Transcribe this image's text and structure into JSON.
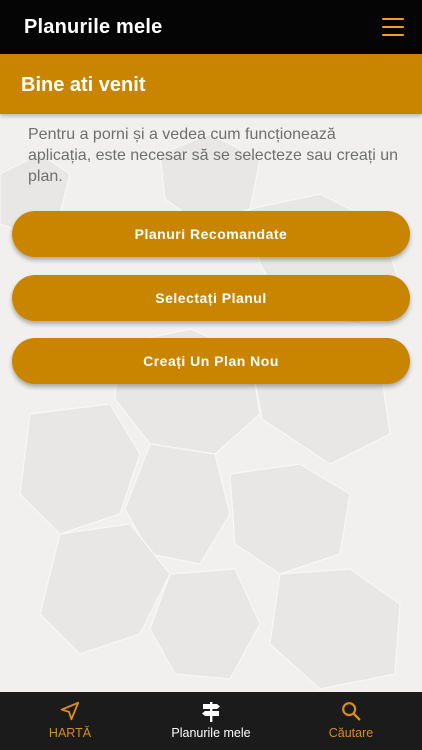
{
  "header": {
    "title": "Planurile mele",
    "menu_icon": "hamburger-menu-icon",
    "accent": "#f0a020"
  },
  "welcome": {
    "title": "Bine ati venit",
    "color": "#c98500"
  },
  "intro": {
    "text": "Pentru a porni și a vedea cum funcționează aplicația, este necesar să se selecteze sau creați un plan."
  },
  "buttons": [
    {
      "label": "Planuri Recomandate"
    },
    {
      "label": "Selectați Planul"
    },
    {
      "label": "Creați Un Plan Nou"
    }
  ],
  "tabs": [
    {
      "label": "HARTĂ",
      "icon": "navigation-arrow-icon",
      "active": false
    },
    {
      "label": "Planurile mele",
      "icon": "signpost-icon",
      "active": true
    },
    {
      "label": "Căutare",
      "icon": "search-icon",
      "active": false
    }
  ]
}
